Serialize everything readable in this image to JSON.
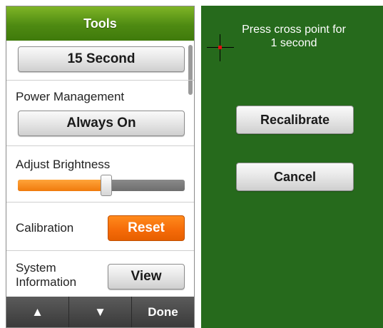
{
  "left": {
    "header_title": "Tools",
    "timeout_button": "15 Second",
    "power": {
      "label": "Power Management",
      "button": "Always On"
    },
    "brightness": {
      "label": "Adjust Brightness",
      "level_percent": 53
    },
    "calibration": {
      "label": "Calibration",
      "button": "Reset"
    },
    "system_info": {
      "label_line1": "System",
      "label_line2": "Information",
      "button": "View"
    },
    "bottom_bar": {
      "up_icon": "▲",
      "down_icon": "▼",
      "done": "Done"
    }
  },
  "right": {
    "instruction_line1": "Press cross point for",
    "instruction_line2": "1 second",
    "recalibrate_button": "Recalibrate",
    "cancel_button": "Cancel"
  },
  "colors": {
    "header_green": "#4e8a12",
    "panel_green": "#266a1c",
    "accent_orange": "#f46a08",
    "cross_dot": "#e01010"
  }
}
